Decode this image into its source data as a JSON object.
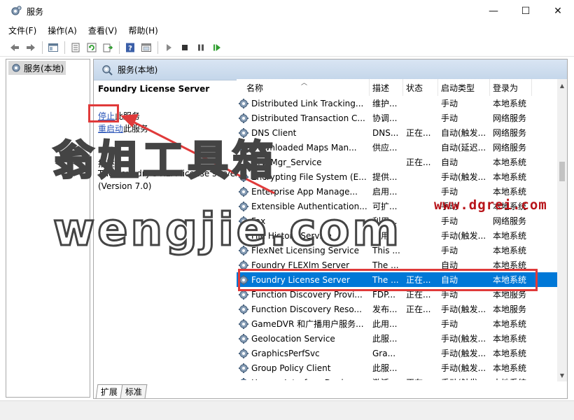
{
  "window": {
    "title": "服务",
    "controls": {
      "minimize": "—",
      "maximize": "☐",
      "close": "✕"
    }
  },
  "menu": [
    "文件(F)",
    "操作(A)",
    "查看(V)",
    "帮助(H)"
  ],
  "toolbar_icons": [
    "back-icon",
    "forward-icon",
    "show-hide-tree-icon",
    "export-icon",
    "refresh-icon",
    "export-list-icon",
    "help-icon",
    "properties-icon",
    "play-icon",
    "stop-icon",
    "pause-icon",
    "restart-icon"
  ],
  "tree": {
    "root_label": "服务(本地)"
  },
  "pane": {
    "header": "服务(本地)",
    "selected_title": "Foundry License Server",
    "stop_link": "停止",
    "stop_suffix": "此服务",
    "restart_link": "重启动",
    "restart_suffix": "此服务",
    "desc_label": "描述:",
    "desc_text_1": "The Foundry's RLM license server",
    "desc_text_2": "(Version 7.0)"
  },
  "columns": {
    "name": "名称",
    "desc": "描述",
    "status": "状态",
    "startup": "启动类型",
    "logon": "登录为"
  },
  "services": [
    {
      "name": "Distributed Link Tracking...",
      "desc": "维护...",
      "status": "",
      "startup": "手动",
      "logon": "本地系统"
    },
    {
      "name": "Distributed Transaction C...",
      "desc": "协调...",
      "status": "",
      "startup": "手动",
      "logon": "网络服务"
    },
    {
      "name": "DNS Client",
      "desc": "DNS...",
      "status": "正在...",
      "startup": "自动(触发...",
      "logon": "网络服务"
    },
    {
      "name": "Downloaded Maps Man...",
      "desc": "供应...",
      "status": "",
      "startup": "自动(延迟...",
      "logon": "网络服务"
    },
    {
      "name": "Drv_Mgr_Service",
      "desc": "",
      "status": "正在...",
      "startup": "自动",
      "logon": "本地系统"
    },
    {
      "name": "Encrypting File System (E...",
      "desc": "提供...",
      "status": "",
      "startup": "手动(触发...",
      "logon": "本地系统"
    },
    {
      "name": "Enterprise App Manage...",
      "desc": "启用...",
      "status": "",
      "startup": "手动",
      "logon": "本地系统"
    },
    {
      "name": "Extensible Authentication...",
      "desc": "可扩...",
      "status": "",
      "startup": "手动",
      "logon": "本地系统"
    },
    {
      "name": "Fax",
      "desc": "利用...",
      "status": "",
      "startup": "手动",
      "logon": "网络服务"
    },
    {
      "name": "File History Service",
      "desc": "将用...",
      "status": "",
      "startup": "手动(触发...",
      "logon": "本地系统"
    },
    {
      "name": "FlexNet Licensing Service",
      "desc": "This ...",
      "status": "",
      "startup": "手动",
      "logon": "本地系统"
    },
    {
      "name": "Foundry FLEXlm Server",
      "desc": "The ...",
      "status": "",
      "startup": "自动",
      "logon": "本地系统"
    },
    {
      "name": "Foundry License Server",
      "desc": "The ...",
      "status": "正在...",
      "startup": "自动",
      "logon": "本地系统",
      "selected": true
    },
    {
      "name": "Function Discovery Provi...",
      "desc": "FDP...",
      "status": "正在...",
      "startup": "手动",
      "logon": "本地服务"
    },
    {
      "name": "Function Discovery Reso...",
      "desc": "发布...",
      "status": "正在...",
      "startup": "手动(触发...",
      "logon": "本地服务"
    },
    {
      "name": "GameDVR 和广播用户服务...",
      "desc": "此用...",
      "status": "",
      "startup": "手动",
      "logon": "本地系统"
    },
    {
      "name": "Geolocation Service",
      "desc": "此服...",
      "status": "",
      "startup": "手动(触发...",
      "logon": "本地系统"
    },
    {
      "name": "GraphicsPerfSvc",
      "desc": "Gra...",
      "status": "",
      "startup": "手动(触发...",
      "logon": "本地系统"
    },
    {
      "name": "Group Policy Client",
      "desc": "此服...",
      "status": "",
      "startup": "手动(触发...",
      "logon": "本地系统"
    },
    {
      "name": "Human Interface Device ...",
      "desc": "激活...",
      "status": "正在...",
      "startup": "手动(触发...",
      "logon": "本地系统"
    }
  ],
  "tabs": [
    "扩展",
    "标准"
  ],
  "watermark": {
    "chinese": "翁姐工具箱",
    "latin": "wengjie.com",
    "url": "www.dgrei.com"
  },
  "colors": {
    "selection": "#0078d7",
    "annotation": "#e03a3a",
    "link": "#2a54b8",
    "url_watermark": "#b8141a"
  }
}
